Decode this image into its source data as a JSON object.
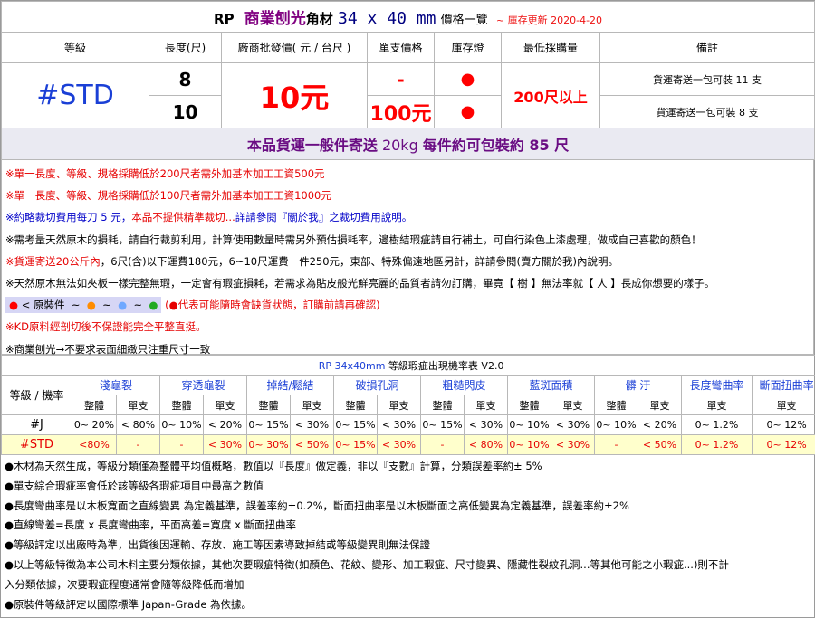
{
  "header": {
    "rp": "RP",
    "product": "商業刨光",
    "kind": "角材",
    "size": "34 x 40 mm",
    "list": "價格一覽",
    "stock_update": "~ 庫存更新 2020-4-20"
  },
  "columns": [
    "等級",
    "長度(尺)",
    "廠商批發價( 元 / 台尺 )",
    "單支價格",
    "庫存燈",
    "最低採購量",
    "備註"
  ],
  "product_row": {
    "grade": "#STD",
    "lengths": [
      "8",
      "10"
    ],
    "wholesale_price": "10元",
    "unit_prices": [
      "-",
      "100元"
    ],
    "stock_light": [
      "●",
      "●"
    ],
    "min_purchase": "200尺以上",
    "remarks": [
      "貨運寄送一包可裝 11 支",
      "貨運寄送一包可裝 8 支"
    ]
  },
  "shipping_bar": {
    "text1": "本品貨運一般件寄送",
    "text2": " 20kg ",
    "text3": "每件約可包裝約 85 尺"
  },
  "notes": {
    "n1": "※單一長度、等級、規格採購低於200尺者需外加基本加工工資500元",
    "n2": "※單一長度、等級、規格採購低於100尺者需外加基本加工工資1000元",
    "n3a": "※約略裁切費用每刀 5 元，",
    "n3b": "本品不提供精準裁切...",
    "n3c": "詳請參閱『關於我』之裁切費用說明。",
    "n4": "※需考量天然原木的損耗，請自行裁剪利用，計算使用數量時需另外預估損耗率，邊樹結瑕疵請自行補土，可自行染色上漆處理，做成自己喜歡的顏色！",
    "n5a": "※貨運寄送20公斤內",
    "n5b": "，6尺(含)以下運費180元，6~10尺運費一件250元，東部、特殊偏遠地區另計，詳請參閱(賣方關於我)內說明。",
    "n6": "※天然原木無法如夾板一樣完整無瑕，一定會有瑕疵損耗，若需求為貼皮般光鮮亮麗的品質者請勿訂購，畢竟【 樹 】無法率就【 人 】長成你想要的樣子。",
    "legend_label": "< 原裝件",
    "legend_tilde": "~",
    "legend_note": "(●代表可能隨時會缺貨狀態，訂購前請再確認)",
    "n8": "※KD原料經剖切後不保證能完全平整直挺。",
    "n9": "※商業刨光→不要求表面細緻只注重尺寸一致"
  },
  "rate_table": {
    "title": "RP 34x40mm",
    "title_small": "等級瑕疵出現機率表 V2.0",
    "grade_header": "等級 / 機率",
    "groups": [
      "淺龜裂",
      "穿透龜裂",
      "掉結/鬆結",
      "破損孔洞",
      "粗糙閃皮",
      "藍斑面積",
      "髒 汙",
      "長度彎曲率",
      "斷面扭曲率"
    ],
    "sub_whole": "整體",
    "sub_single": "單支",
    "rows": [
      {
        "grade": "#J",
        "cells": [
          "0~ 20%",
          "< 80%",
          "0~ 10%",
          "< 20%",
          "0~ 15%",
          "< 30%",
          "0~ 15%",
          "< 30%",
          "0~ 15%",
          "< 30%",
          "0~ 10%",
          "< 30%",
          "0~ 10%",
          "< 20%",
          "0~ 1.2%",
          "0~ 12%"
        ]
      },
      {
        "grade": "#STD",
        "cells": [
          "<80%",
          "-",
          "-",
          "< 30%",
          "0~ 30%",
          "< 50%",
          "0~ 15%",
          "< 30%",
          "-",
          "< 80%",
          "0~ 10%",
          "< 30%",
          "-",
          "< 50%",
          "0~ 1.2%",
          "0~ 12%"
        ]
      }
    ]
  },
  "bottom_notes": {
    "b1": "●木材為天然生成，等級分類僅為整體平均值概略，數值以『長度』做定義，非以『支數』計算，分類誤差率約± 5%",
    "b2": "●單支綜合瑕疵率會低於該等級各瑕疵項目中最高之數值",
    "b3": "●長度彎曲率是以木板寬面之直線變異 為定義基準，誤差率約±0.2%，斷面扭曲率是以木板斷面之高低變異為定義基準，誤差率約±2%",
    "b4": "●直線彎差=長度 x 長度彎曲率，平面高差=寬度 x 斷面扭曲率",
    "b5": "●等級評定以出廠時為準，出貨後因運輸、存放、施工等因素導致掉結或等級變異則無法保證",
    "b6": "●以上等級特徵為本公司木料主要分類依據，其他次要瑕疵特徵(如顏色、花紋、變形、加工瑕疵、尺寸變異、隱藏性裂紋孔洞...等其他可能之小瑕疵...)則不計",
    "b7": "入分類依據，次要瑕疵程度通常會隨等級降低而增加",
    "b8": "●原裝件等級評定以國際標準 Japan-Grade 為依據。"
  },
  "colors": {
    "red": "#ff0000",
    "blue": "#1a3fd6",
    "purple": "#800080",
    "std_highlight": "#ffffcc",
    "legend_bg": "#d6d6f5",
    "legend_dots": [
      "#ff0000",
      "#ff8c00",
      "#6fa8ff",
      "#22aa22"
    ]
  }
}
